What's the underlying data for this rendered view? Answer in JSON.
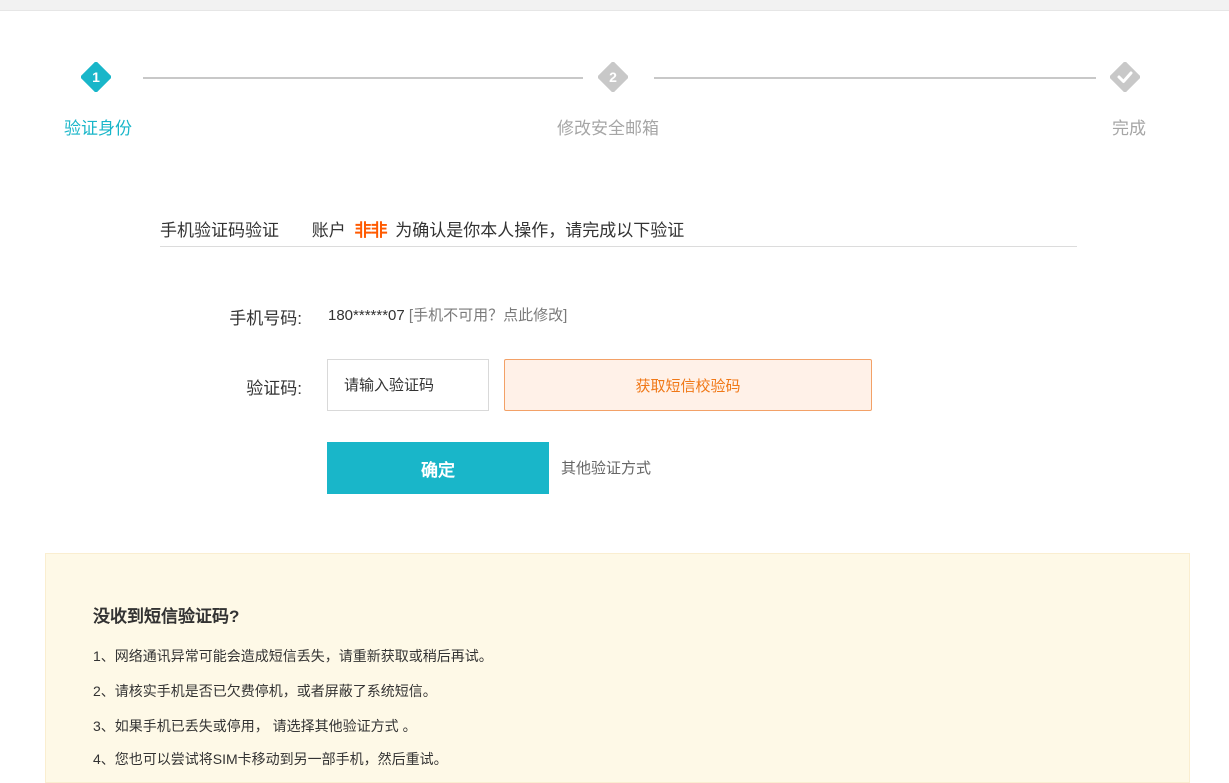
{
  "colors": {
    "accent": "#19b6c9",
    "inactive": "#c8c8c8",
    "warning_orange": "#f07817",
    "help_bg": "#fef9e7"
  },
  "steps": [
    {
      "number": "1",
      "label": "验证身份",
      "state": "active"
    },
    {
      "number": "2",
      "label": "修改安全邮箱",
      "state": "pending"
    },
    {
      "icon": "check-icon",
      "label": "完成",
      "state": "pending"
    }
  ],
  "heading": {
    "title": "手机验证码验证",
    "account_prefix": "账户",
    "account_name": "非非",
    "message": "为确认是你本人操作，请完成以下验证"
  },
  "form": {
    "phone_label": "手机号码:",
    "phone_value": "180******07",
    "phone_change_link": "[手机不可用？点此修改]",
    "code_label": "验证码:",
    "code_placeholder": "请输入验证码",
    "code_value": "",
    "sms_button": "获取短信校验码",
    "confirm_button": "确定",
    "other_methods_link": "其他验证方式"
  },
  "help": {
    "title": "没收到短信验证码?",
    "items": [
      "1、网络通讯异常可能会造成短信丢失，请重新获取或稍后再试。",
      "2、请核实手机是否已欠费停机，或者屏蔽了系统短信。",
      "3、如果手机已丢失或停用， 请选择其他验证方式 。",
      "4、您也可以尝试将SIM卡移动到另一部手机，然后重试。"
    ]
  }
}
